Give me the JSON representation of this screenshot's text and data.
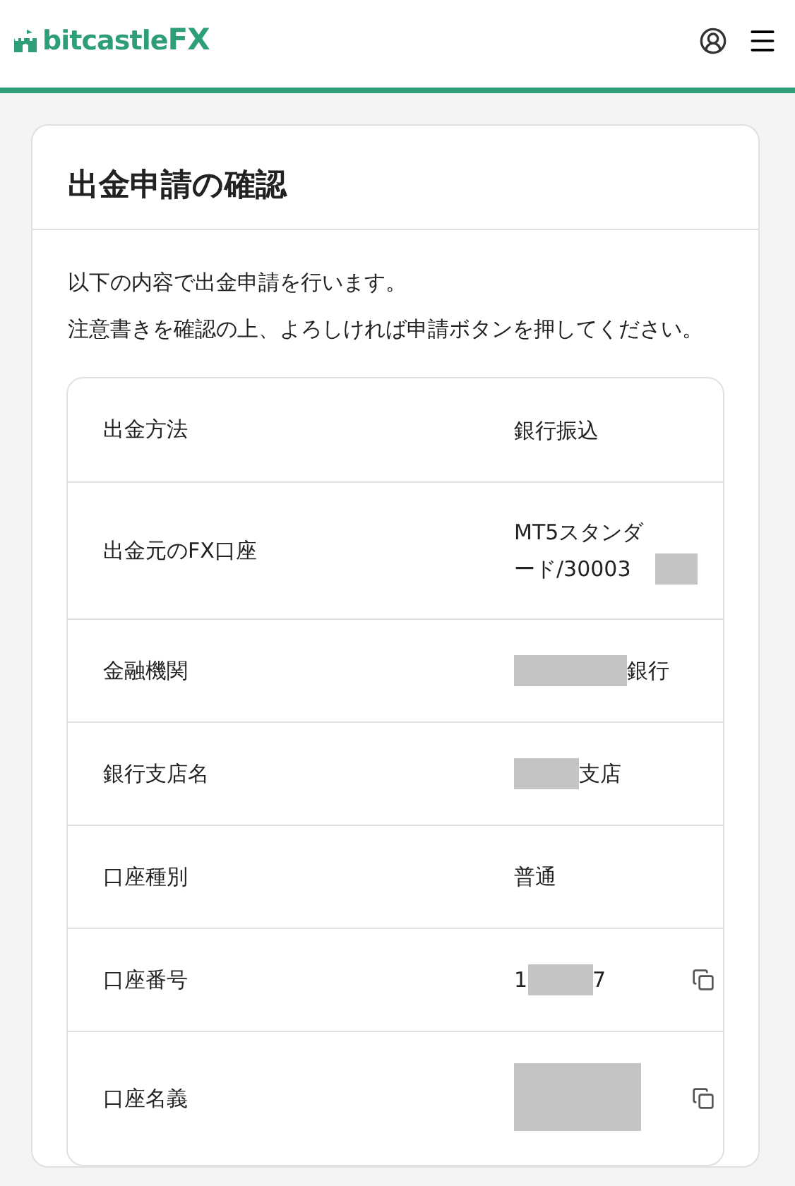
{
  "header": {
    "logo_text": "bitcastle",
    "logo_accent": "FX"
  },
  "card": {
    "title": "出金申請の確認",
    "intro": [
      "以下の内容で出金申請を行います。",
      "注意書きを確認の上、よろしければ申請ボタンを押してください。"
    ],
    "rows": [
      {
        "label": "出金方法",
        "value": [
          {
            "kind": "text",
            "text": "銀行振込"
          }
        ],
        "copyable": false
      },
      {
        "label": "出金元のFX口座",
        "value": [
          {
            "kind": "text",
            "text": "MT5スタンダード/30003"
          },
          {
            "kind": "redacted_short"
          }
        ],
        "copyable": false
      },
      {
        "label": "金融機関",
        "value": [
          {
            "kind": "redacted_long"
          },
          {
            "kind": "text",
            "text": "銀行"
          }
        ],
        "copyable": false
      },
      {
        "label": "銀行支店名",
        "value": [
          {
            "kind": "redacted"
          },
          {
            "kind": "text",
            "text": "支店"
          }
        ],
        "copyable": false
      },
      {
        "label": "口座種別",
        "value": [
          {
            "kind": "text",
            "text": "普通"
          }
        ],
        "copyable": false
      },
      {
        "label": "口座番号",
        "value": [
          {
            "kind": "text",
            "text": "1"
          },
          {
            "kind": "redacted"
          },
          {
            "kind": "text",
            "text": "7"
          }
        ],
        "copyable": true
      },
      {
        "label": "口座名義",
        "value": [
          {
            "kind": "redacted_block"
          }
        ],
        "copyable": true
      }
    ]
  }
}
